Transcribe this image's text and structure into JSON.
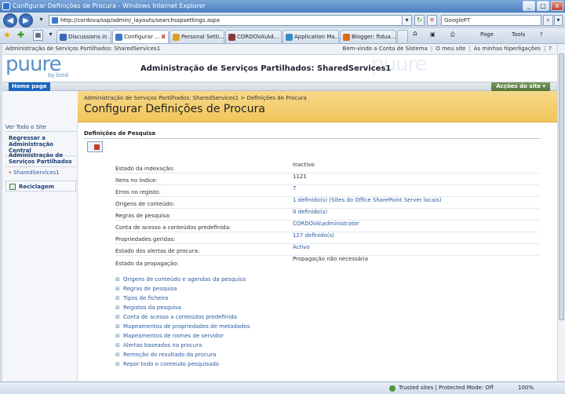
{
  "window": {
    "title": "Configurar Definições de Procura - Windows Internet Explorer",
    "btn_min": "_",
    "btn_max": "□",
    "btn_close": "x"
  },
  "address": {
    "url": "http://cordova/ssp/admin/_layouts/searchsspsettings.aspx",
    "search_value": "GooglePT",
    "back_glyph": "◀",
    "forward_glyph": "▶",
    "dropdown_glyph": "▾",
    "refresh_glyph": "↻",
    "stop_glyph": "✕",
    "search_glyph": "⌕"
  },
  "tabs": [
    {
      "label": "Discussions in ...",
      "color": "#3a6ab0"
    },
    {
      "label": "Configurar ...",
      "color": "#3a78c8",
      "active": true
    },
    {
      "label": "Personal Setti...",
      "color": "#e0a020"
    },
    {
      "label": "CORDOVA\\Ad...",
      "color": "#8a3a3a"
    },
    {
      "label": "Application Ma...",
      "color": "#3a8ac8"
    },
    {
      "label": "Blogger: ftdua...",
      "color": "#e06a10"
    }
  ],
  "tab_close": "x",
  "commands": {
    "home_glyph": "⌂",
    "feeds_glyph": "▣",
    "print_glyph": "⎙",
    "page": "Page",
    "tools": "Tools",
    "help_glyph": "?"
  },
  "sp_topbar": {
    "site": "Administração de Serviços Partilhados: SharedServices1",
    "welcome": "Bem-vindo a Conta de Sistema",
    "my_site": "O meu site",
    "my_links": "As minhas hiperligações",
    "sep": "|",
    "help_glyph": "?"
  },
  "header": {
    "logo": "puure",
    "logo_sub": "by bind",
    "title": "Administração de Serviços Partilhados: SharedServices1"
  },
  "nav": {
    "home": "Home page",
    "actions": "Acções do site ▾"
  },
  "left_nav": {
    "view_all": "Ver Todo o Site",
    "back": "Regressar a Administração Central",
    "ssa": "Administração de Serviços Partilhados",
    "ssp": "SharedServices1",
    "recycle": "Reciclagem",
    "bullet": "•"
  },
  "title_area": {
    "breadcrumb": "Administração de Serviços Partilhados: SharedServices1 > Definições de Procura",
    "title": "Configurar Definições de Procura"
  },
  "section": {
    "heading": "Definições de Pesquisa"
  },
  "settings": [
    {
      "label": "Estado da indexação:",
      "value": "Inactivo",
      "link": false
    },
    {
      "label": "Itens no índice:",
      "value": "1121",
      "link": false
    },
    {
      "label": "Erros no registo:",
      "value": "7",
      "link": true
    },
    {
      "label": "Origens de conteúdo:",
      "value": "1 definido(s) (Sites do Office SharePoint Server locais)",
      "link": true
    },
    {
      "label": "Regras de pesquisa:",
      "value": "0 definido(s)",
      "link": true
    },
    {
      "label": "Conta de acesso a conteúdos predefinida:",
      "value": "CORDOVA\\administrator",
      "link": true
    },
    {
      "label": "Propriedades geridas:",
      "value": "127 definido(s)",
      "link": true
    },
    {
      "label": "Estado dos alertas de procura:",
      "value": "Activo",
      "link": true
    },
    {
      "label": "Estado da propagação:",
      "value": "Propagação não necessária",
      "link": false
    }
  ],
  "links": [
    "Origens de conteúdo e agendas da pesquisa",
    "Regras de pesquisa",
    "Tipos de ficheiro",
    "Registos da pesquisa",
    "Conta de acesso a conteúdos predefinida",
    "Mapeamentos de propriedades de metadados",
    "Mapeamentos de nomes de servidor",
    "Alertas baseados na procura",
    "Remoção do resultado da procura",
    "Repor todo o conteúdo pesquisado"
  ],
  "link_bullet": "⊞",
  "status": {
    "trusted": "Trusted sites | Protected Mode: Off",
    "zoom": "100%"
  }
}
